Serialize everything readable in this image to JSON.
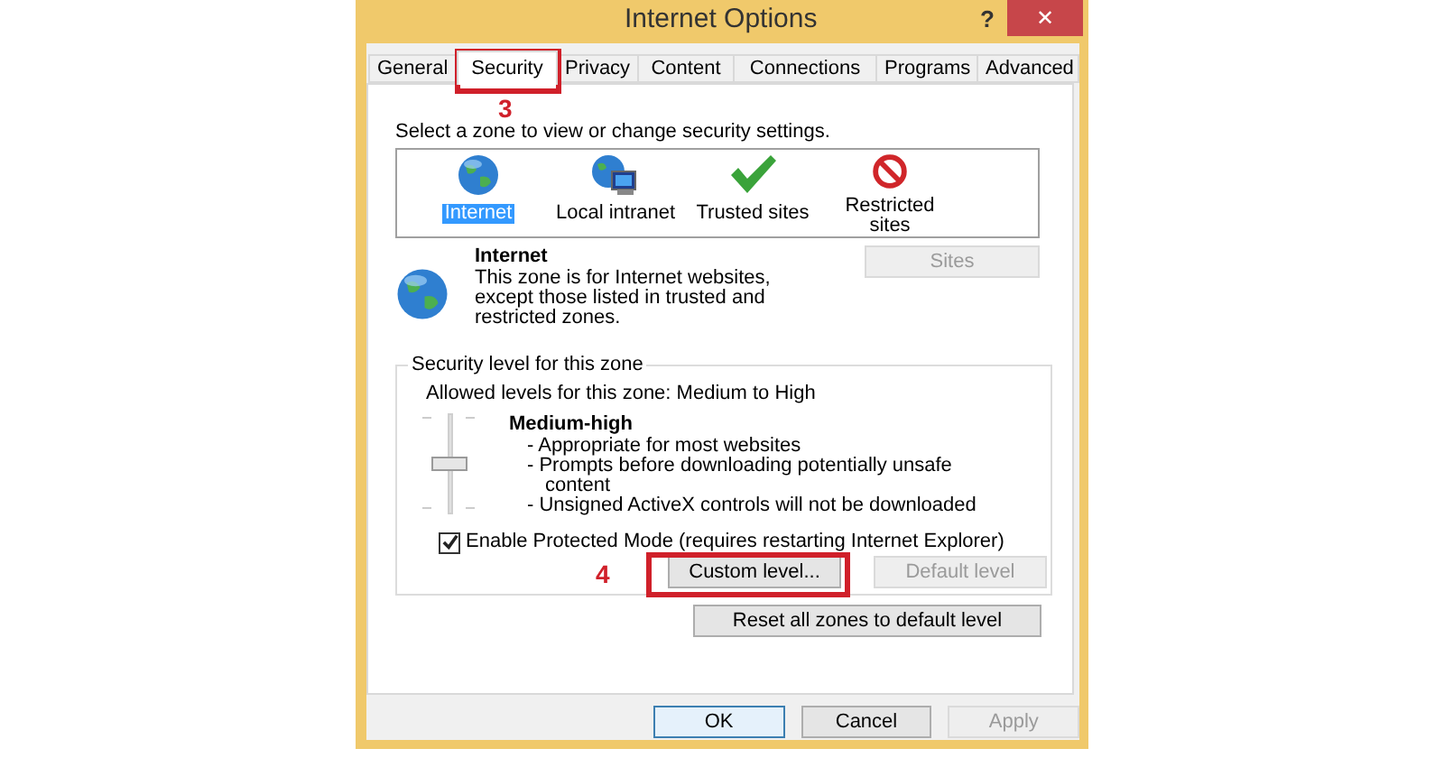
{
  "window": {
    "title": "Internet Options",
    "help": "?",
    "close": "✕"
  },
  "tabs": [
    {
      "label": "General",
      "selected": false
    },
    {
      "label": "Security",
      "selected": true
    },
    {
      "label": "Privacy",
      "selected": false
    },
    {
      "label": "Content",
      "selected": false
    },
    {
      "label": "Connections",
      "selected": false
    },
    {
      "label": "Programs",
      "selected": false
    },
    {
      "label": "Advanced",
      "selected": false
    }
  ],
  "zone_prompt": "Select a zone to view or change security settings.",
  "zones": [
    {
      "label": "Internet",
      "kind": "globe",
      "selected": true
    },
    {
      "label": "Local intranet",
      "kind": "intranet",
      "selected": false
    },
    {
      "label": "Trusted sites",
      "kind": "trusted",
      "selected": false
    },
    {
      "label": "Restricted sites",
      "kind": "restricted",
      "selected": false
    }
  ],
  "zone_info": {
    "title": "Internet",
    "description": "This zone is for Internet websites, except those listed in trusted and restricted zones.",
    "sites_button": {
      "label": "Sites",
      "disabled": true
    }
  },
  "security_level": {
    "legend": "Security level for this zone",
    "allowed": "Allowed levels for this zone: Medium to High",
    "level": 0.5,
    "level_name": "Medium-high",
    "details": [
      "- Appropriate for most websites",
      "- Prompts before downloading potentially unsafe content",
      "- Unsigned ActiveX controls will not be downloaded"
    ],
    "protected_mode": {
      "label": "Enable Protected Mode (requires restarting Internet Explorer)",
      "checked": true
    },
    "buttons": [
      {
        "label": "Custom level...",
        "disabled": false
      },
      {
        "label": "Default level",
        "disabled": true
      }
    ]
  },
  "reset_button": {
    "label": "Reset all zones to default level"
  },
  "dialog_buttons": [
    {
      "label": "OK",
      "disabled": false,
      "default": true
    },
    {
      "label": "Cancel",
      "disabled": false,
      "default": false
    },
    {
      "label": "Apply",
      "disabled": true,
      "default": false
    }
  ],
  "annotations": [
    {
      "label": "3",
      "kind": "tab"
    },
    {
      "label": "4",
      "kind": "button"
    }
  ]
}
